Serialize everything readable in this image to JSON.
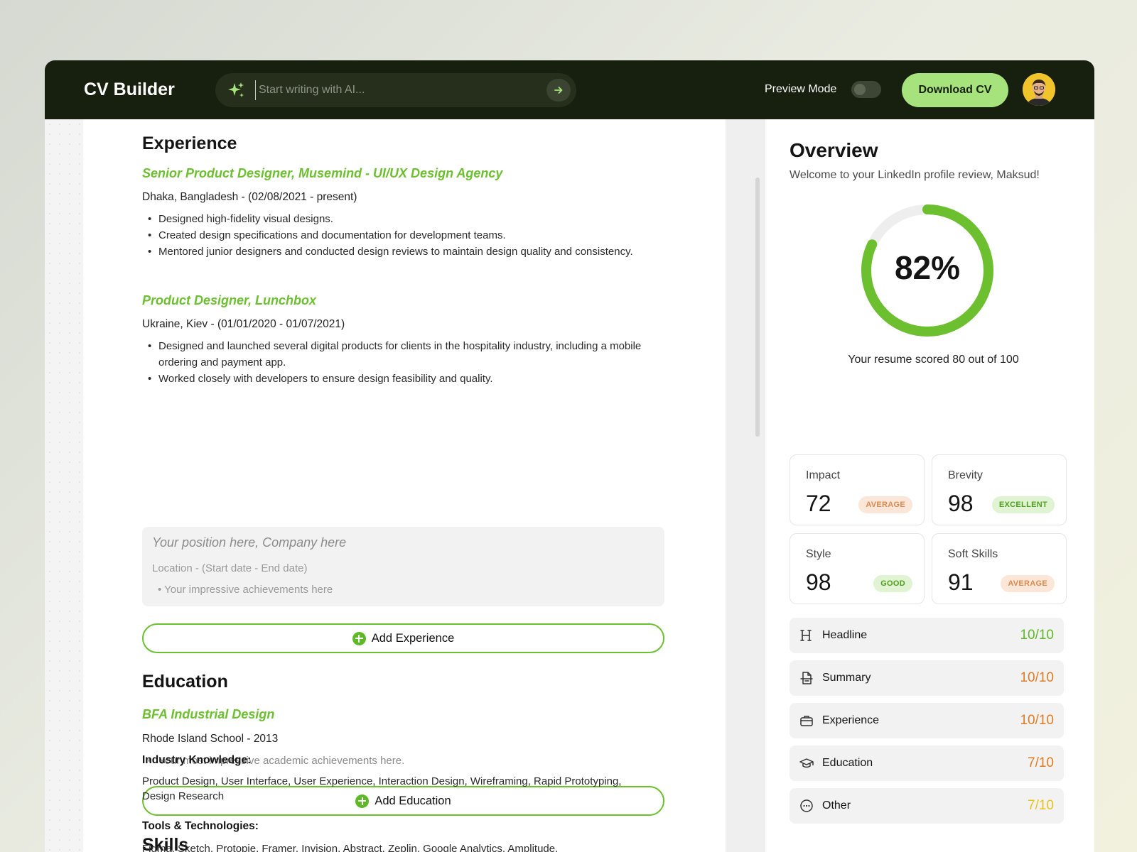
{
  "app": {
    "title": "CV Builder"
  },
  "ai_search": {
    "placeholder": "Start writing with AI..."
  },
  "header": {
    "preview_label": "Preview Mode",
    "preview_on": false,
    "download_label": "Download CV"
  },
  "experience": {
    "title": "Experience",
    "jobs": [
      {
        "title": "Senior Product Designer, Musemind - UI/UX Design Agency",
        "meta": "Dhaka, Bangladesh - (02/08/2021 - present)",
        "bullets": [
          "Designed high-fidelity visual designs.",
          "Created design specifications and documentation for development teams.",
          "Mentored junior designers and conducted design reviews to maintain design quality and consistency."
        ]
      },
      {
        "title": "Product Designer, Lunchbox",
        "meta": "Ukraine, Kiev - (01/01/2020 - 01/07/2021)",
        "bullets": [
          "Designed and launched several digital products for clients in the hospitality industry, including a mobile ordering and payment app.",
          "Worked closely with developers to ensure design feasibility and quality."
        ]
      }
    ],
    "placeholder": {
      "title": "Your position here, Company here",
      "meta": "Location - (Start date - End date)",
      "bullet": "Your impressive achievements here"
    },
    "add_label": "Add Experience"
  },
  "education": {
    "title": "Education",
    "degree": "BFA Industrial Design",
    "meta": "Rhode Island School - 2013",
    "bullet": "Your most impressive academic achievements here.",
    "add_label": "Add Education"
  },
  "skills": {
    "title": "Skills",
    "industry_head": "Industry Knowledge:",
    "industry_text": "Product Design, User Interface, User Experience, Interaction Design, Wireframing, Rapid Prototyping, Design Research",
    "tools_head": "Tools & Technologies:",
    "tools_text": "Figma, Sketch, Protopie, Framer, Invision, Abstract, Zeplin, Google Analytics, Amplitude,"
  },
  "overview": {
    "title": "Overview",
    "subtitle": "Welcome to your LinkedIn profile review, Maksud!",
    "percent": 82,
    "percent_label": "82%",
    "score_text": "Your resume scored 80 out of 100",
    "metrics": [
      {
        "label": "Impact",
        "value": "72",
        "badge": "AVERAGE"
      },
      {
        "label": "Brevity",
        "value": "98",
        "badge": "EXCELLENT"
      },
      {
        "label": "Style",
        "value": "98",
        "badge": "GOOD"
      },
      {
        "label": "Soft Skills",
        "value": "91",
        "badge": "AVERAGE"
      }
    ],
    "sections": [
      {
        "label": "Headline",
        "score": "10/10",
        "icon": "heading-icon",
        "color": "#5fb827"
      },
      {
        "label": "Summary",
        "score": "10/10",
        "icon": "document-icon",
        "color": "#e07b22"
      },
      {
        "label": "Experience",
        "score": "10/10",
        "icon": "briefcase-icon",
        "color": "#e07b22"
      },
      {
        "label": "Education",
        "score": "7/10",
        "icon": "graduation-cap-icon",
        "color": "#e07b22"
      },
      {
        "label": "Other",
        "score": "7/10",
        "icon": "more-icon",
        "color": "#e8c21a"
      }
    ]
  },
  "colors": {
    "accent": "#6cbf2e",
    "topbar": "#17200e",
    "button": "#a7e37c"
  }
}
